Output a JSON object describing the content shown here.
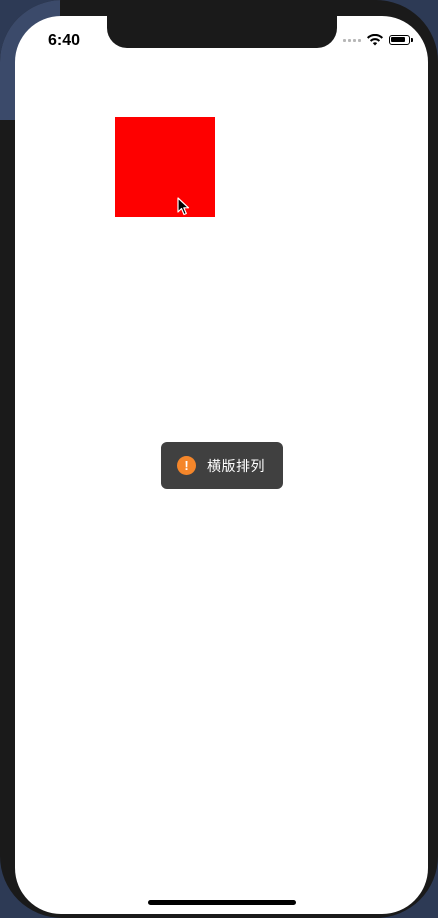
{
  "status_bar": {
    "time": "6:40",
    "battery_level": 0.9,
    "icons": [
      "cellular-signal-icon",
      "wifi-icon",
      "battery-icon"
    ]
  },
  "canvas": {
    "square_color": "#fe0000"
  },
  "toast": {
    "icon": "warning-icon",
    "icon_glyph": "!",
    "icon_color": "#f5862a",
    "message": "横版排列"
  }
}
